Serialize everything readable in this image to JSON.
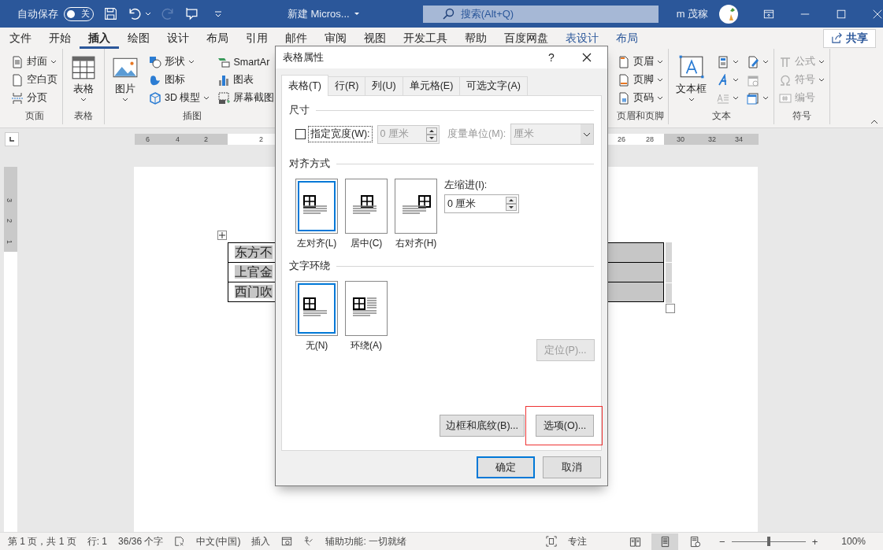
{
  "title_bar": {
    "autosave_label": "自动保存",
    "autosave_toggle": {
      "on": false,
      "label": "关"
    },
    "redo": {
      "disabled": true
    },
    "document_title": "新建 Micros...",
    "search": {
      "placeholder": "搜索(Alt+Q)"
    },
    "user_name": "m 茂稼"
  },
  "ribbon_tabs": [
    {
      "label": "文件",
      "selected": false,
      "contextual": false
    },
    {
      "label": "开始",
      "selected": false,
      "contextual": false
    },
    {
      "label": "插入",
      "selected": true,
      "contextual": false
    },
    {
      "label": "绘图",
      "selected": false,
      "contextual": false
    },
    {
      "label": "设计",
      "selected": false,
      "contextual": false
    },
    {
      "label": "布局",
      "selected": false,
      "contextual": false
    },
    {
      "label": "引用",
      "selected": false,
      "contextual": false
    },
    {
      "label": "邮件",
      "selected": false,
      "contextual": false
    },
    {
      "label": "审阅",
      "selected": false,
      "contextual": false
    },
    {
      "label": "视图",
      "selected": false,
      "contextual": false
    },
    {
      "label": "开发工具",
      "selected": false,
      "contextual": false
    },
    {
      "label": "帮助",
      "selected": false,
      "contextual": false
    },
    {
      "label": "百度网盘",
      "selected": false,
      "contextual": false
    },
    {
      "label": "表设计",
      "selected": false,
      "contextual": true
    },
    {
      "label": "布局",
      "selected": false,
      "contextual": true
    }
  ],
  "share_button": "共享",
  "ribbon_groups_left": [
    {
      "label": "页面",
      "columns": [
        [
          {
            "kind": "small",
            "label": "封面",
            "dropdown": true,
            "disabled": false
          },
          {
            "kind": "small",
            "label": "空白页",
            "dropdown": false,
            "disabled": false
          },
          {
            "kind": "small",
            "label": "分页",
            "dropdown": false,
            "disabled": false
          }
        ]
      ]
    },
    {
      "label": "表格",
      "columns": [
        [
          {
            "kind": "large",
            "label": "表格",
            "dropdown": true,
            "disabled": false
          }
        ]
      ]
    },
    {
      "label": "插图",
      "columns": [
        [
          {
            "kind": "large",
            "label": "图片",
            "dropdown": true,
            "disabled": false
          }
        ],
        [
          {
            "kind": "small",
            "label": "形状",
            "dropdown": true,
            "disabled": false
          },
          {
            "kind": "small",
            "label": "图标",
            "dropdown": false,
            "disabled": false
          },
          {
            "kind": "small",
            "label": "3D 模型",
            "dropdown": true,
            "disabled": false
          }
        ],
        [
          {
            "kind": "small",
            "label": "SmartAr",
            "dropdown": false,
            "disabled": false
          },
          {
            "kind": "small",
            "label": "图表",
            "dropdown": false,
            "disabled": false
          },
          {
            "kind": "small",
            "label": "屏幕截图",
            "dropdown": false,
            "disabled": false
          }
        ]
      ]
    }
  ],
  "ribbon_groups_right": [
    {
      "label": "页眉和页脚",
      "columns": [
        [
          {
            "kind": "small",
            "label": "页眉",
            "dropdown": true,
            "disabled": false
          },
          {
            "kind": "small",
            "label": "页脚",
            "dropdown": true,
            "disabled": false
          },
          {
            "kind": "small",
            "label": "页码",
            "dropdown": true,
            "disabled": false
          }
        ]
      ]
    },
    {
      "label": "文本",
      "columns": [
        [
          {
            "kind": "large",
            "label": "文本框",
            "dropdown": true,
            "disabled": false
          }
        ],
        [
          {
            "kind": "icon",
            "dropdown": true,
            "disabled": false
          },
          {
            "kind": "icon",
            "dropdown": true,
            "disabled": false
          },
          {
            "kind": "icon",
            "dropdown": true,
            "disabled": true
          }
        ],
        [
          {
            "kind": "icon",
            "dropdown": true,
            "disabled": false
          },
          {
            "kind": "icon",
            "dropdown": false,
            "disabled": true
          },
          {
            "kind": "icon",
            "dropdown": true,
            "disabled": false
          }
        ]
      ]
    },
    {
      "label": "符号",
      "columns": [
        [
          {
            "kind": "small",
            "label": "公式",
            "dropdown": true,
            "disabled": true
          },
          {
            "kind": "small",
            "label": "符号",
            "dropdown": true,
            "disabled": true
          },
          {
            "kind": "small",
            "label": "编号",
            "dropdown": false,
            "disabled": true
          }
        ]
      ]
    }
  ],
  "ruler": {
    "horizontal_numbers": [
      "6",
      "4",
      "2",
      "2",
      "26",
      "28",
      "30",
      "32",
      "34"
    ],
    "vertical_numbers": [
      "3",
      "2",
      "1"
    ]
  },
  "document_table": {
    "rows": [
      {
        "column_1": "东方不"
      },
      {
        "column_1": "上官金"
      },
      {
        "column_1": "西门吹"
      }
    ]
  },
  "dialog": {
    "title": "表格属性",
    "help": "?",
    "tabs": [
      {
        "label": "表格(T)",
        "selected": true
      },
      {
        "label": "行(R)",
        "selected": false
      },
      {
        "label": "列(U)",
        "selected": false
      },
      {
        "label": "单元格(E)",
        "selected": false
      },
      {
        "label": "可选文字(A)",
        "selected": false
      }
    ],
    "size_section": {
      "heading": "尺寸",
      "preferred_width": {
        "label": "指定宽度(W):",
        "checked": false
      },
      "width_field": {
        "value": "0 厘米",
        "disabled": true
      },
      "unit_label": {
        "label": "度量单位(M):",
        "disabled": true
      },
      "unit_dropdown": {
        "value": "厘米",
        "disabled": true
      }
    },
    "alignment_section": {
      "heading": "对齐方式",
      "options": [
        {
          "label": "左对齐(L)",
          "selected": true
        },
        {
          "label": "居中(C)",
          "selected": false
        },
        {
          "label": "右对齐(H)",
          "selected": false
        }
      ],
      "indent_label": "左缩进(I):",
      "indent_field": {
        "value": "0 厘米"
      }
    },
    "wrapping_section": {
      "heading": "文字环绕",
      "options": [
        {
          "label": "无(N)",
          "selected": true
        },
        {
          "label": "环绕(A)",
          "selected": false
        }
      ],
      "position_button": {
        "label": "定位(P)...",
        "disabled": true
      }
    },
    "borders_button": "边框和底纹(B)...",
    "options_button": {
      "label": "选项(O)...",
      "highlighted": true
    },
    "ok_button": "确定",
    "cancel_button": "取消"
  },
  "status_bar": {
    "page": "第 1 页，共 1 页",
    "line": "行: 1",
    "word_count": "36/36 个字",
    "language": "中文(中国)",
    "input_mode": "插入",
    "accessibility": "辅助功能: 一切就绪",
    "focus": "专注",
    "views": [
      {
        "selected": false
      },
      {
        "selected": true
      },
      {
        "selected": false
      }
    ],
    "zoom": {
      "minus": "−",
      "level": 0.5,
      "plus": "+",
      "reading": "100%"
    }
  }
}
